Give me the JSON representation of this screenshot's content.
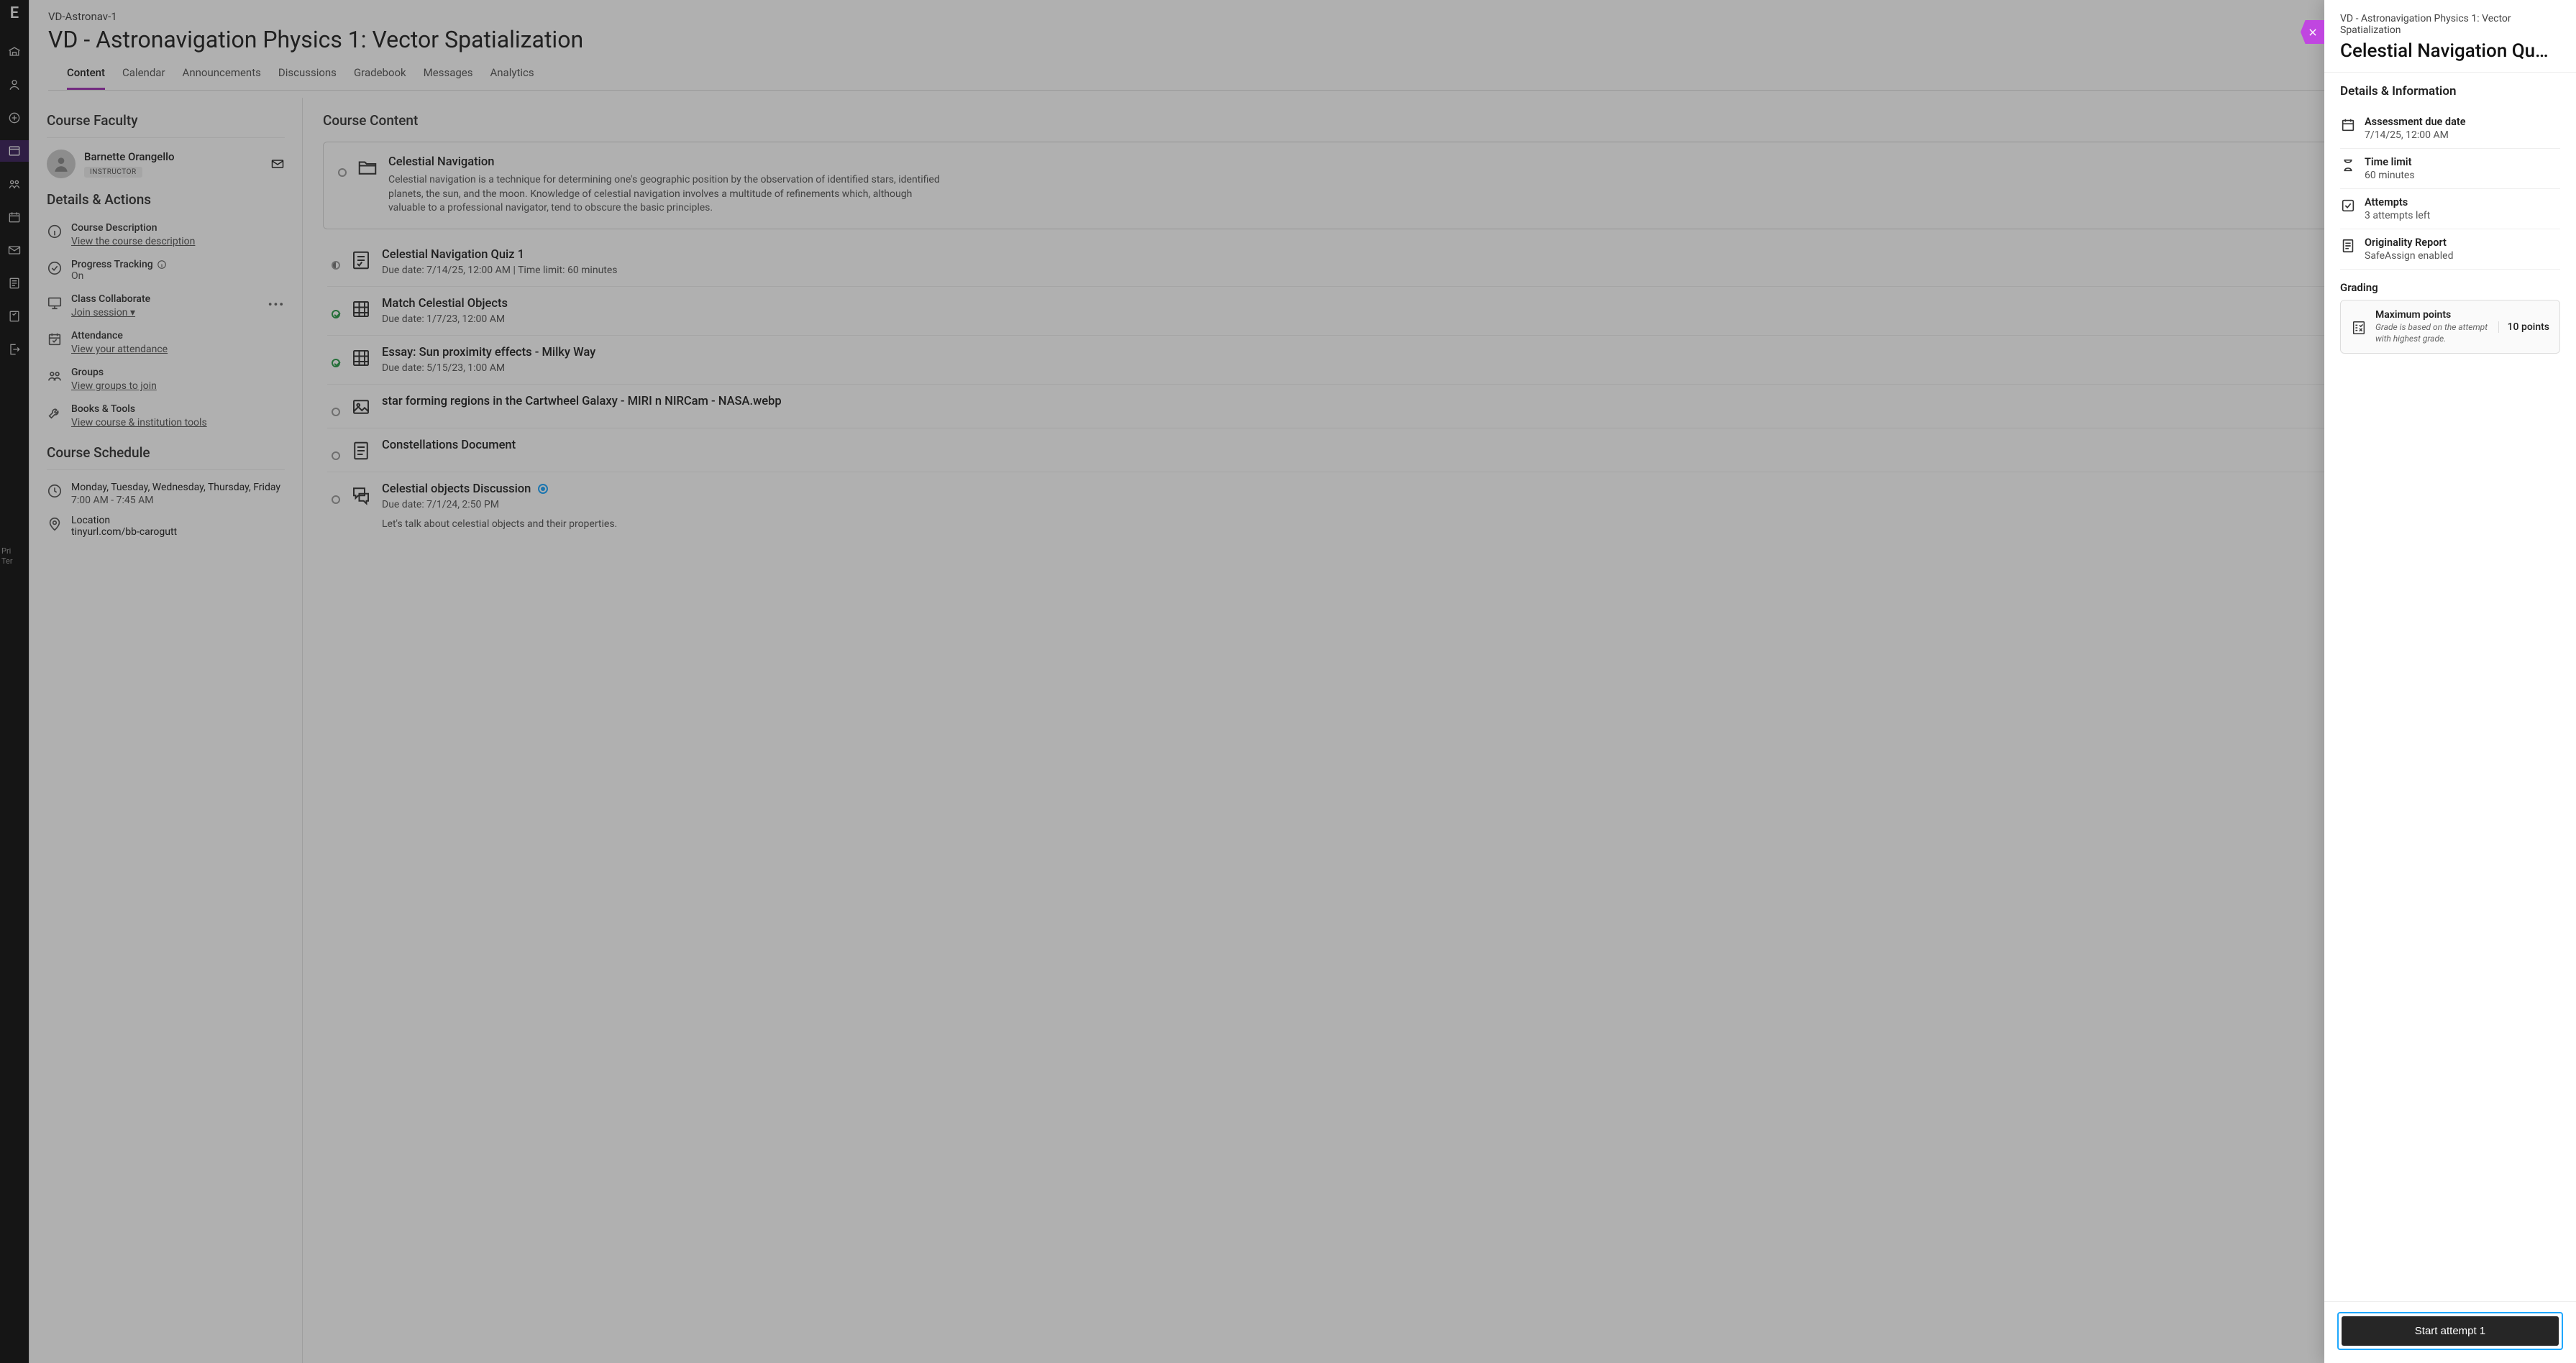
{
  "rail": {
    "brand_letter": "E",
    "cut1": "Pri",
    "cut2": "Ter"
  },
  "header": {
    "breadcrumb": "VD-Astronav-1",
    "title": "VD - Astronavigation Physics 1: Vector Spatialization"
  },
  "tabs": [
    "Content",
    "Calendar",
    "Announcements",
    "Discussions",
    "Gradebook",
    "Messages",
    "Analytics"
  ],
  "sidebar": {
    "faculty_heading": "Course Faculty",
    "faculty_name": "Barnette Orangello",
    "role": "INSTRUCTOR",
    "da_heading": "Details & Actions",
    "course_desc_label": "Course Description",
    "course_desc_link": "View the course description",
    "progress_label": "Progress Tracking",
    "progress_value": "On",
    "collab_label": "Class Collaborate",
    "collab_link": "Join session",
    "attendance_label": "Attendance",
    "attendance_link": "View your attendance",
    "groups_label": "Groups",
    "groups_link": "View groups to join",
    "books_label": "Books & Tools",
    "books_link": "View course & institution tools",
    "schedule_heading": "Course Schedule",
    "schedule_days": "Monday, Tuesday, Wednesday, Thursday, Friday",
    "schedule_time": "7:00 AM - 7:45 AM",
    "location_label": "Location",
    "location_link": "tinyurl.com/bb-carogutt"
  },
  "content": {
    "heading": "Course Content",
    "module": {
      "title": "Celestial Navigation",
      "desc": "Celestial navigation is a technique for determining one's geographic position by the observation of identified stars, identified planets, the sun, and the moon. Knowledge of celestial navigation involves a multitude of refinements which, although valuable to a professional navigator, tend to obscure the basic principles."
    },
    "items": [
      {
        "title": "Celestial Navigation Quiz 1",
        "sub": "Due date: 7/14/25, 12:00 AM | Time limit: 60 minutes",
        "status": "half",
        "icon": "quiz"
      },
      {
        "title": "Match Celestial Objects",
        "sub": "Due date: 1/7/23, 12:00 AM",
        "status": "done",
        "icon": "grid"
      },
      {
        "title": "Essay: Sun proximity effects - Milky Way",
        "sub": "Due date: 5/15/23, 1:00 AM",
        "status": "done",
        "icon": "grid"
      },
      {
        "title": "star forming regions in the Cartwheel Galaxy - MIRI n NIRCam - NASA.webp",
        "sub": "",
        "status": "open",
        "icon": "image"
      },
      {
        "title": "Constellations Document",
        "sub": "",
        "status": "open",
        "icon": "doc"
      },
      {
        "title": "Celestial objects Discussion",
        "sub": "Due date: 7/1/24, 2:50 PM",
        "desc": "Let's talk about celestial objects and their properties.",
        "status": "open",
        "icon": "chat",
        "badge": true
      }
    ]
  },
  "panel": {
    "breadcrumb": "VD - Astronavigation Physics 1: Vector Spatialization",
    "title": "Celestial Navigation Qu…",
    "details_heading": "Details & Information",
    "rows": {
      "due_label": "Assessment due date",
      "due_value": "7/14/25, 12:00 AM",
      "time_label": "Time limit",
      "time_value": "60 minutes",
      "attempts_label": "Attempts",
      "attempts_value": "3 attempts left",
      "orig_label": "Originality Report",
      "orig_value": "SafeAssign enabled"
    },
    "grading_heading": "Grading",
    "grade_title": "Maximum points",
    "grade_sub": "Grade is based on the attempt with highest grade.",
    "grade_points": "10 points",
    "start_label": "Start attempt 1"
  }
}
